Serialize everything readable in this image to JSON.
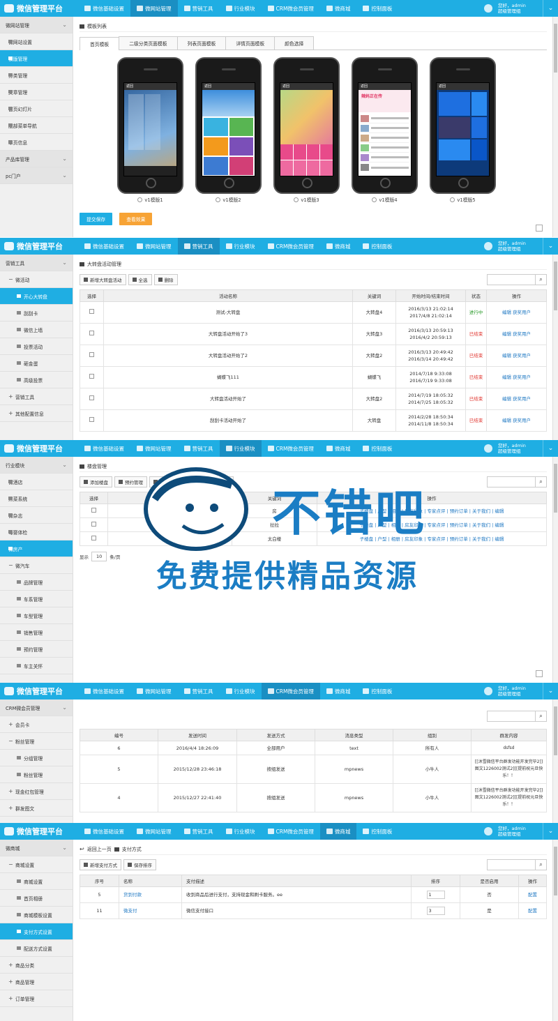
{
  "brand": "微信管理平台",
  "user": {
    "greeting": "您好，admin",
    "role": "超级管理组"
  },
  "nav": [
    "微信基础设置",
    "微网站管理",
    "营销工具",
    "行业模块",
    "CRM微会员管理",
    "微商城",
    "控制面板"
  ],
  "panel1": {
    "sidebar": [
      {
        "label": "微网站管理",
        "type": "group"
      },
      {
        "label": "微网站设置",
        "type": "item"
      },
      {
        "label": "模版管理",
        "type": "item",
        "active": true
      },
      {
        "label": "分类管理",
        "type": "item"
      },
      {
        "label": "文章管理",
        "type": "item"
      },
      {
        "label": "首页幻灯片",
        "type": "item"
      },
      {
        "label": "底部菜单导航",
        "type": "item"
      },
      {
        "label": "单页信息",
        "type": "item"
      },
      {
        "label": "产品库管理",
        "type": "group"
      },
      {
        "label": "pc门户",
        "type": "group"
      }
    ],
    "crumb": "模板列表",
    "tabs": [
      "首页模板",
      "二级分类页面模板",
      "列表页面模板",
      "详情页面模板",
      "颜色选择"
    ],
    "templates": [
      "v1模版1",
      "v1模版2",
      "v1模版3",
      "v1模版4",
      "v1模版5"
    ],
    "screen_texts": {
      "back": "返回",
      "promo": "辣妈正在传"
    },
    "buttons": {
      "save": "提交保存",
      "preview": "查看效果"
    }
  },
  "panel2": {
    "sidebar": [
      {
        "label": "营销工具",
        "type": "group"
      },
      {
        "label": "微活动",
        "type": "tree"
      },
      {
        "label": "开心大转盘",
        "type": "deep",
        "active": true
      },
      {
        "label": "刮刮卡",
        "type": "deep"
      },
      {
        "label": "微信上墙",
        "type": "deep"
      },
      {
        "label": "投票活动",
        "type": "deep"
      },
      {
        "label": "砸金蛋",
        "type": "deep"
      },
      {
        "label": "高级投票",
        "type": "deep"
      },
      {
        "label": "营销工具",
        "type": "treeplus"
      },
      {
        "label": "其他配置信息",
        "type": "treeplus"
      }
    ],
    "crumb": "大转盘活动管理",
    "toolbar": [
      "新增大转盘活动",
      "全选",
      "删除"
    ],
    "headers": [
      "选择",
      "活动名称",
      "关键词",
      "开始时间/结束时间",
      "状态",
      "操作"
    ],
    "rows": [
      {
        "name": "测试-大转盘",
        "kw": "大转盘4",
        "start": "2016/3/13 21:02:14",
        "end": "2017/4/8 21:02:14",
        "status": "进行中",
        "st": "green"
      },
      {
        "name": "大转盘活动开始了3",
        "kw": "大转盘3",
        "start": "2016/3/13 20:59:13",
        "end": "2016/4/2 20:59:13",
        "status": "已结束",
        "st": "red"
      },
      {
        "name": "大转盘活动开始了2",
        "kw": "大转盘2",
        "start": "2016/3/13 20:49:42",
        "end": "2016/3/14 20:49:42",
        "status": "已结束",
        "st": "red"
      },
      {
        "name": "蝴蝶飞111",
        "kw": "蝴蝶飞",
        "start": "2014/7/18 9:33:08",
        "end": "2016/7/19 9:33:08",
        "status": "已结束",
        "st": "red"
      },
      {
        "name": "大转盘活动开始了",
        "kw": "大转盘2",
        "start": "2014/7/19 18:05:32",
        "end": "2014/7/25 18:05:32",
        "status": "已结束",
        "st": "red"
      },
      {
        "name": "刮刮卡活动开始了",
        "kw": "大转盘",
        "start": "2014/2/28 18:50:34",
        "end": "2014/11/8 18:50:34",
        "status": "已结束",
        "st": "red"
      }
    ],
    "ops": {
      "edit": "编辑",
      "winners": "获奖用户"
    }
  },
  "panel3": {
    "sidebar": [
      {
        "label": "行业模块",
        "type": "group"
      },
      {
        "label": "微酒店",
        "type": "item"
      },
      {
        "label": "点菜系统",
        "type": "item"
      },
      {
        "label": "微杂志",
        "type": "item"
      },
      {
        "label": "母婴体检",
        "type": "item"
      },
      {
        "label": "微房产",
        "type": "item",
        "active": true
      },
      {
        "label": "微汽车",
        "type": "tree"
      },
      {
        "label": "品牌管理",
        "type": "deep"
      },
      {
        "label": "车系管理",
        "type": "deep"
      },
      {
        "label": "车型管理",
        "type": "deep"
      },
      {
        "label": "销售管理",
        "type": "deep"
      },
      {
        "label": "预约管理",
        "type": "deep"
      },
      {
        "label": "车主关怀",
        "type": "deep"
      }
    ],
    "crumb": "楼盘管理",
    "toolbar": [
      "添加楼盘",
      "预约管理",
      "楼盘管理",
      "全选",
      "删除"
    ],
    "headers": [
      "选择",
      "楼盘名称",
      "关键词",
      "操作"
    ],
    "rows": [
      {
        "name": "哈我说的",
        "kw": "房"
      },
      {
        "name": "这是一楼盘的楼盘",
        "kw": "拉拉"
      },
      {
        "name": "太白楼",
        "kw": "太白楼"
      }
    ],
    "ops": "子楼盘 | 户型 | 相册 | 房友印象 | 专家点评 | 预约订单 | 关于我们 | 编辑",
    "pager": {
      "show": "显示",
      "size": "10",
      "unit": "条/页"
    },
    "watermark": {
      "line1": "不错吧",
      "line2": "免费提供精品资源"
    }
  },
  "panel4": {
    "sidebar": [
      {
        "label": "CRM微会员管理",
        "type": "group"
      },
      {
        "label": "会员卡",
        "type": "treeplus"
      },
      {
        "label": "粉丝管理",
        "type": "tree"
      },
      {
        "label": "分组管理",
        "type": "deep"
      },
      {
        "label": "粉丝管理",
        "type": "deep"
      },
      {
        "label": "现金红包管理",
        "type": "treeplus"
      },
      {
        "label": "群发图文",
        "type": "treeplus"
      }
    ],
    "headers": [
      "编号",
      "发送时间",
      "发送方式",
      "消息类型",
      "组别",
      "群发内容"
    ],
    "rows": [
      {
        "id": "6",
        "time": "2016/4/4 18:26:09",
        "mode": "全部用户",
        "type": "text",
        "group": "所有人",
        "content": "dsfsd"
      },
      {
        "id": "5",
        "time": "2015/12/28 23:46:18",
        "mode": "按组发送",
        "type": "mpnews",
        "group": "小牛人",
        "content": "[[沐雪微信平台群发功能开发完毕2]]图文1226002测试2][[提前祝元旦快乐！！"
      },
      {
        "id": "4",
        "time": "2015/12/27 22:41:40",
        "mode": "按组发送",
        "type": "mpnews",
        "group": "小牛人",
        "content": "[[沐雪微信平台群发功能开发完毕2]]图文1226002测试2][[提前祝元旦快乐！！"
      }
    ]
  },
  "panel5": {
    "sidebar": [
      {
        "label": "微商城",
        "type": "group"
      },
      {
        "label": "商城设置",
        "type": "tree"
      },
      {
        "label": "商城设置",
        "type": "deep"
      },
      {
        "label": "首页相册",
        "type": "deep"
      },
      {
        "label": "商城模板设置",
        "type": "deep"
      },
      {
        "label": "支付方式设置",
        "type": "deep",
        "active": true
      },
      {
        "label": "配送方式设置",
        "type": "deep"
      },
      {
        "label": "商品分类",
        "type": "treeplus"
      },
      {
        "label": "商品管理",
        "type": "treeplus"
      },
      {
        "label": "订单管理",
        "type": "treeplus"
      }
    ],
    "crumb_back": "返回上一页",
    "crumb": "支付方式",
    "toolbar": [
      "新增支付方式",
      "保存排序"
    ],
    "headers": [
      "序号",
      "名称",
      "支付描述",
      "排序",
      "是否启用",
      "操作"
    ],
    "rows": [
      {
        "id": "5",
        "name": "货到付款",
        "desc": "收到商品后进行支付，支持现金和刷卡服务。ee",
        "sort": "1",
        "enabled": "否",
        "op": "配置"
      },
      {
        "id": "11",
        "name": "微支付",
        "desc": "微信支付接口",
        "sort": "3",
        "enabled": "是",
        "op": "配置"
      }
    ]
  },
  "colors": {
    "primary": "#1faee3",
    "dark": "#1a8fc3",
    "orange": "#f7a335",
    "red": "#e0302a",
    "green": "#2a9a2a"
  }
}
